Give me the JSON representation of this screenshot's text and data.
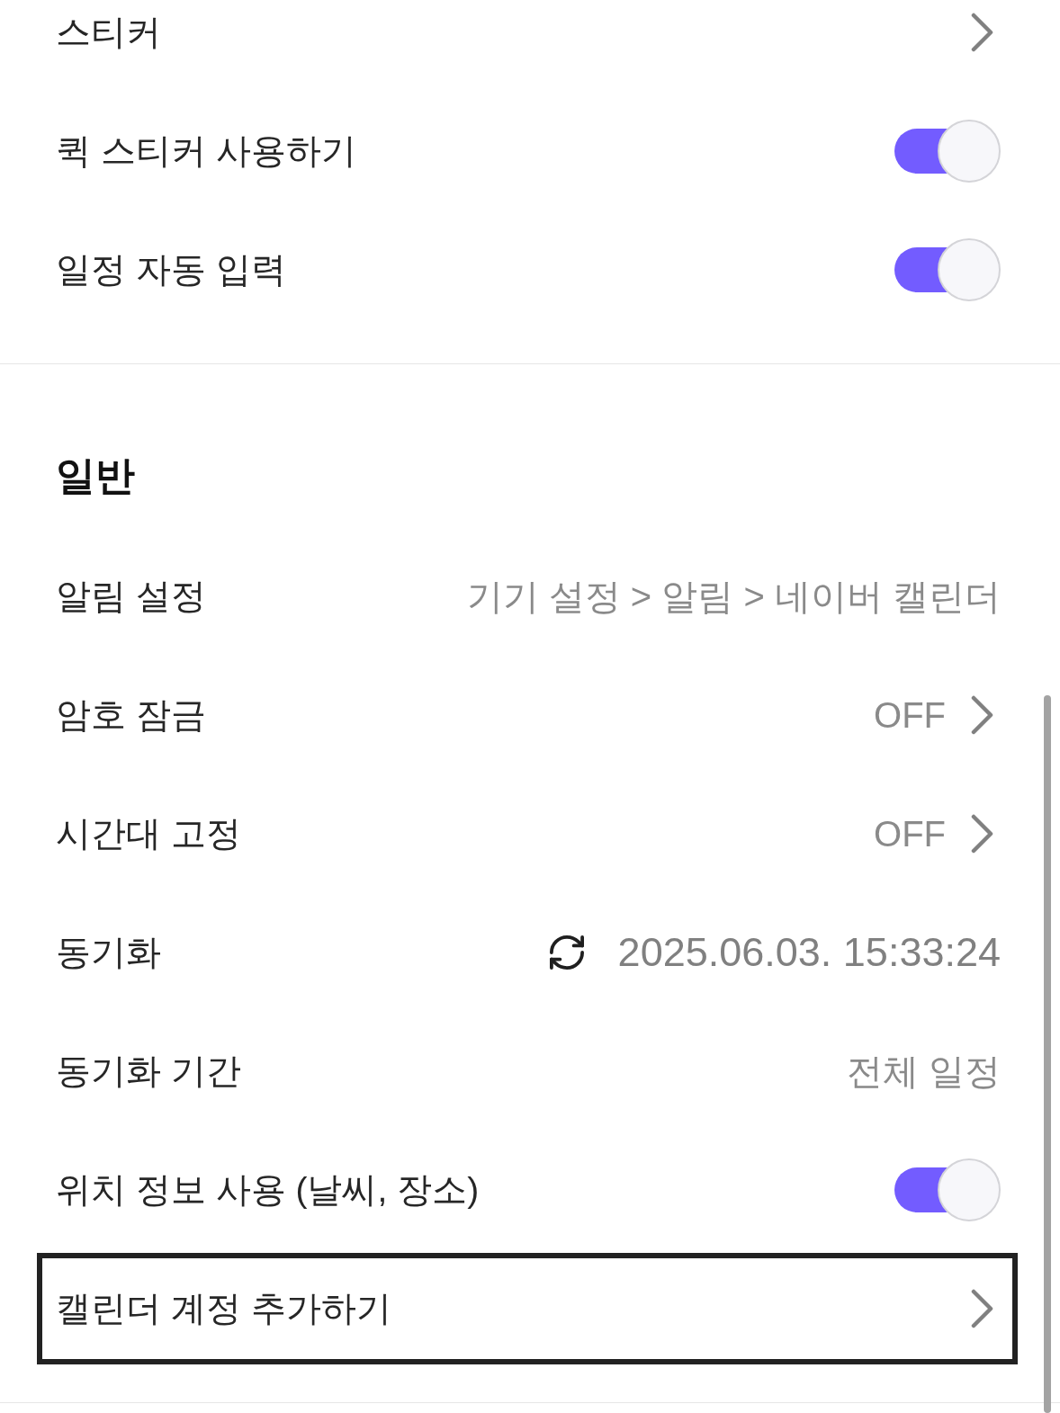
{
  "sections": [
    {
      "rows": [
        {
          "kind": "link",
          "label": "스티커",
          "highlighted": false
        },
        {
          "kind": "toggle",
          "label": "퀵 스티커 사용하기",
          "on": true,
          "highlighted": false
        },
        {
          "kind": "toggle",
          "label": "일정 자동 입력",
          "on": true,
          "highlighted": false
        }
      ]
    },
    {
      "title": "일반",
      "rows": [
        {
          "kind": "value",
          "label": "알림 설정",
          "value": "기기 설정 > 알림 > 네이버 캘린더",
          "highlighted": false
        },
        {
          "kind": "link",
          "label": "암호 잠금",
          "value": "OFF",
          "highlighted": false
        },
        {
          "kind": "link",
          "label": "시간대 고정",
          "value": "OFF",
          "highlighted": false
        },
        {
          "kind": "sync",
          "label": "동기화",
          "value": "2025.06.03. 15:33:24",
          "highlighted": false
        },
        {
          "kind": "value",
          "label": "동기화 기간",
          "value": "전체 일정",
          "highlighted": false
        },
        {
          "kind": "toggle",
          "label": "위치 정보 사용 (날씨, 장소)",
          "on": true,
          "highlighted": false
        },
        {
          "kind": "link",
          "label": "캘린더 계정 추가하기",
          "highlighted": true
        }
      ]
    }
  ]
}
